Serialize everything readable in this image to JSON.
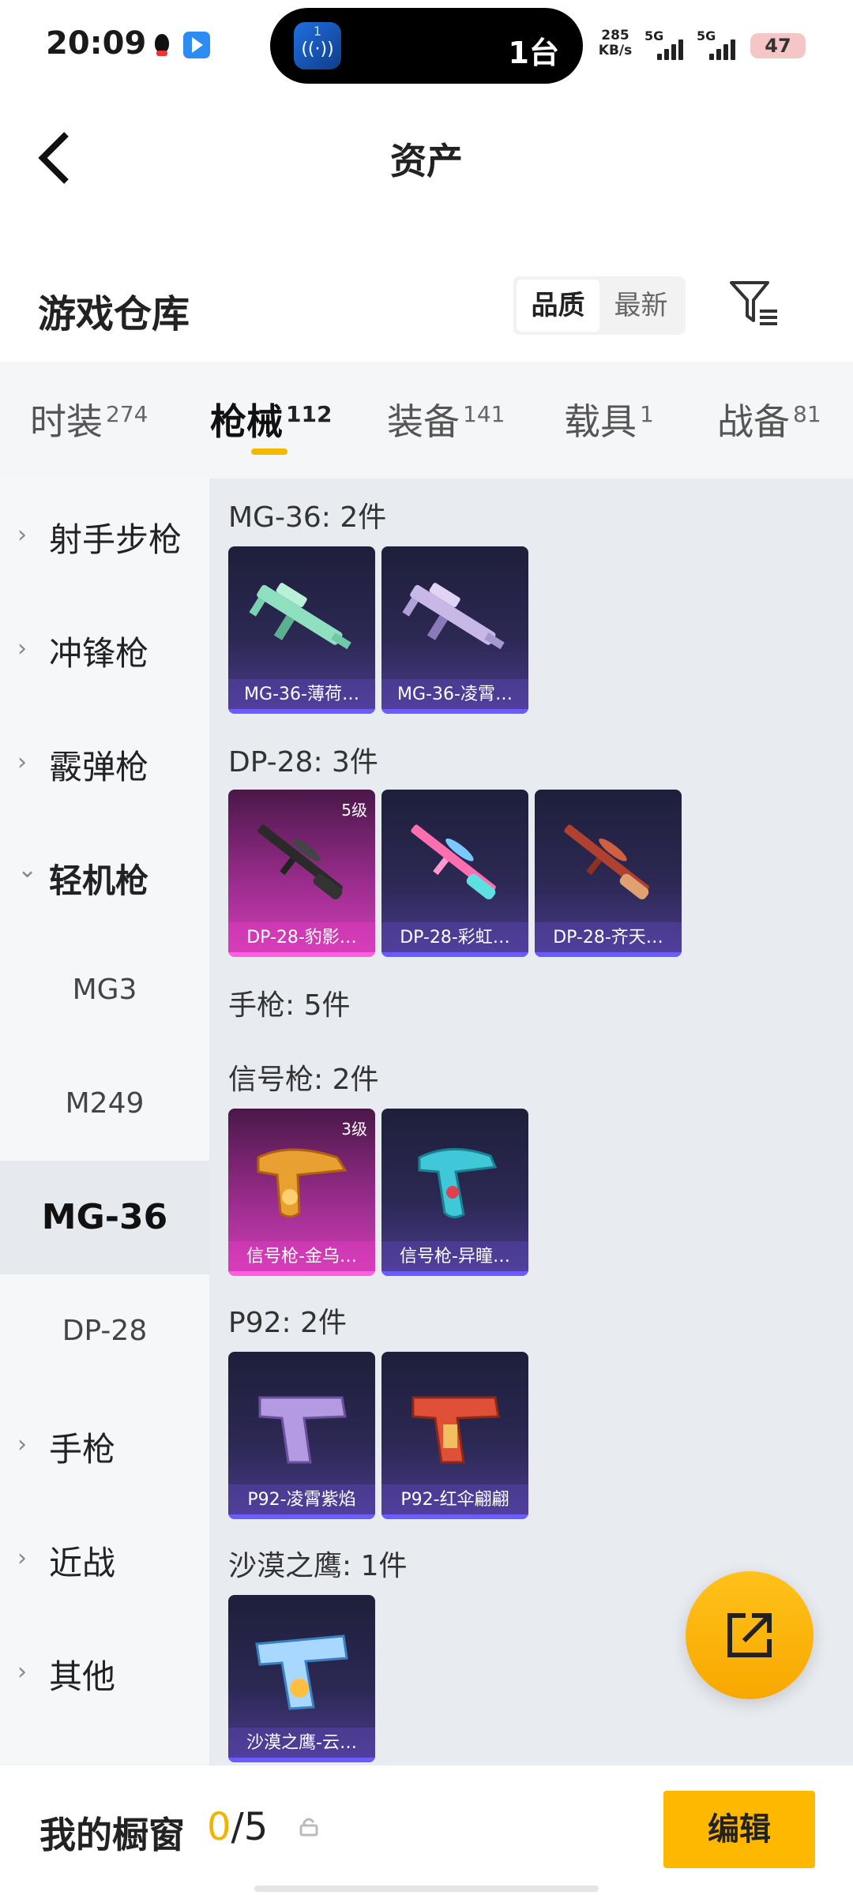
{
  "status_bar": {
    "time": "20:09",
    "island_app_num": "1",
    "island_app_wave": "((·))",
    "island_text": "1台",
    "net_speed_value": "285",
    "net_speed_unit": "KB/s",
    "sig1_label": "5G",
    "sig2_label": "5G",
    "battery": "47"
  },
  "header": {
    "title": "资产"
  },
  "section": {
    "title": "游戏仓库",
    "sort_quality": "品质",
    "sort_newest": "最新"
  },
  "tabs": [
    {
      "label": "时装",
      "count": "274"
    },
    {
      "label": "枪械",
      "count": "112"
    },
    {
      "label": "装备",
      "count": "141"
    },
    {
      "label": "载具",
      "count": "1"
    },
    {
      "label": "战备",
      "count": "81"
    }
  ],
  "sidebar": {
    "items": [
      "射手步枪",
      "冲锋枪",
      "霰弹枪",
      "轻机枪",
      "手枪",
      "近战",
      "其他"
    ],
    "subitems": [
      "MG3",
      "M249",
      "MG-36",
      "DP-28"
    ],
    "chevron_right": "›",
    "chevron_down": "⌄"
  },
  "groups": [
    {
      "title": "MG-36: 2件",
      "items": [
        {
          "name": "MG-36-薄荷…"
        },
        {
          "name": "MG-36-凌霄…"
        }
      ]
    },
    {
      "title": "DP-28: 3件",
      "items": [
        {
          "name": "DP-28-豹影…",
          "level": "5级"
        },
        {
          "name": "DP-28-彩虹…"
        },
        {
          "name": "DP-28-齐天…"
        }
      ]
    },
    {
      "title": "手枪: 5件"
    },
    {
      "title": "信号枪: 2件",
      "items": [
        {
          "name": "信号枪-金乌…",
          "level": "3级"
        },
        {
          "name": "信号枪-异瞳…"
        }
      ]
    },
    {
      "title": "P92: 2件",
      "items": [
        {
          "name": "P92-凌霄紫焰"
        },
        {
          "name": "P92-红伞翩翩"
        }
      ]
    },
    {
      "title": "沙漠之鹰: 1件",
      "items": [
        {
          "name": "沙漠之鹰-云…"
        }
      ]
    }
  ],
  "bottom": {
    "showcase_label": "我的橱窗",
    "current": "0",
    "total": "/5",
    "edit_label": "编辑"
  },
  "colors": {
    "accent": "#ffb800",
    "epic": "#d23fb8",
    "rare": "#4a3b8c"
  }
}
